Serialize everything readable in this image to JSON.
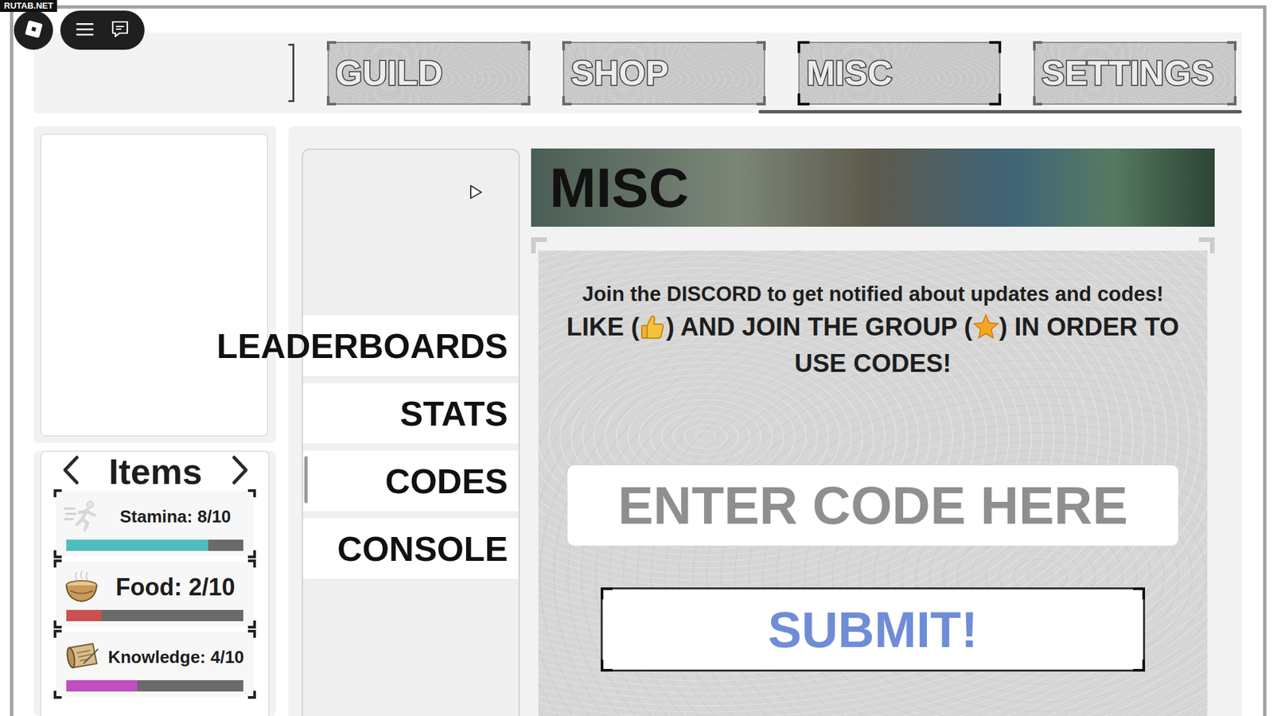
{
  "watermark": "RUTAB.NET",
  "tabs": [
    {
      "label": "GUILD",
      "selected": false
    },
    {
      "label": "SHOP",
      "selected": false
    },
    {
      "label": "MISC",
      "selected": true
    },
    {
      "label": "SETTINGS",
      "selected": false
    }
  ],
  "tabs_scrollbar": {
    "thumb": 0.4,
    "position": 1
  },
  "items_panel": {
    "title": "Items",
    "stats": [
      {
        "label": "Stamina: 8/10",
        "level": 0.8,
        "color": "#4ebdbd"
      },
      {
        "label": "Food: 2/10",
        "level": 0.2,
        "color": "#c9514f"
      },
      {
        "label": "Knowledge: 4/10",
        "level": 0.4,
        "color": "#c04fbf"
      }
    ]
  },
  "menu": [
    {
      "label": "LEADERBOARDS",
      "selected": false
    },
    {
      "label": "STATS",
      "selected": false
    },
    {
      "label": "CODES",
      "selected": true
    },
    {
      "label": "CONSOLE",
      "selected": false
    }
  ],
  "banner": {
    "title": "MISC"
  },
  "codes": {
    "notice": "Join the DISCORD to get notified about updates and codes!",
    "instructions": [
      "LIKE (",
      ") AND JOIN THE GROUP (",
      ") IN ORDER TO USE CODES!"
    ],
    "input": {
      "placeholder": "ENTER CODE HERE"
    },
    "submit": "SUBMIT!"
  }
}
